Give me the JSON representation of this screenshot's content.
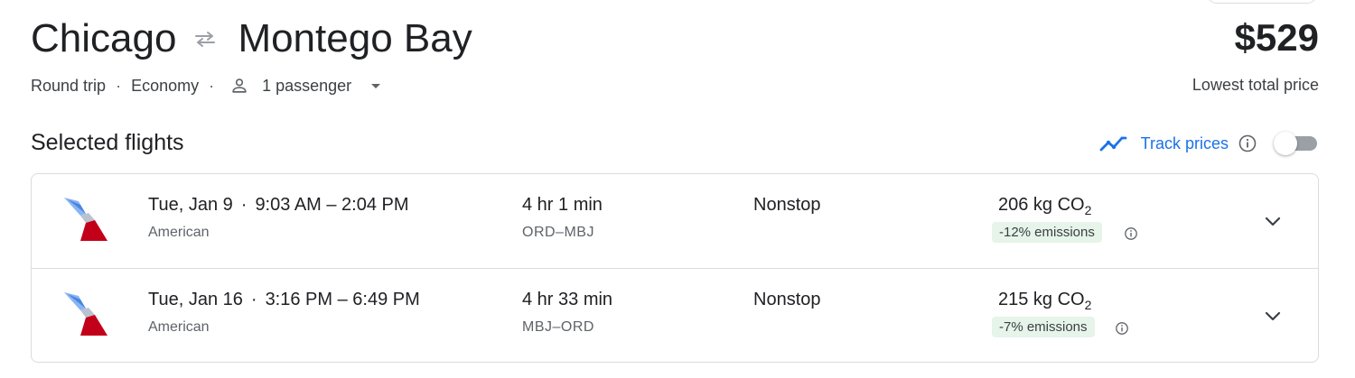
{
  "header": {
    "origin": "Chicago",
    "destination": "Montego Bay",
    "price": "$529",
    "price_label": "Lowest total price"
  },
  "trip_options": {
    "trip_type": "Round trip",
    "cabin": "Economy",
    "passengers": "1 passenger"
  },
  "selected_flights": {
    "title": "Selected flights",
    "track_prices_label": "Track prices",
    "track_prices_on": false
  },
  "flights": [
    {
      "date": "Tue, Jan 9",
      "times": "9:03 AM – 2:04 PM",
      "airline": "American",
      "duration": "4 hr 1 min",
      "airports": "ORD–MBJ",
      "stops": "Nonstop",
      "emissions_value": "206 kg CO",
      "emissions_sub": "2",
      "emissions_badge": "-12% emissions"
    },
    {
      "date": "Tue, Jan 16",
      "times": "3:16 PM – 6:49 PM",
      "airline": "American",
      "duration": "4 hr 33 min",
      "airports": "MBJ–ORD",
      "stops": "Nonstop",
      "emissions_value": "215 kg CO",
      "emissions_sub": "2",
      "emissions_badge": "-7% emissions"
    }
  ],
  "colors": {
    "accent": "#1a73e8",
    "badge_bg": "#e6f4ea",
    "aa_red": "#c30019",
    "aa_blue": "#0078d2"
  },
  "icons": {
    "swap": "swap-arrows-icon",
    "passenger": "person-icon",
    "trend": "trending-icon",
    "info": "info-icon",
    "expand": "chevron-down-icon"
  }
}
